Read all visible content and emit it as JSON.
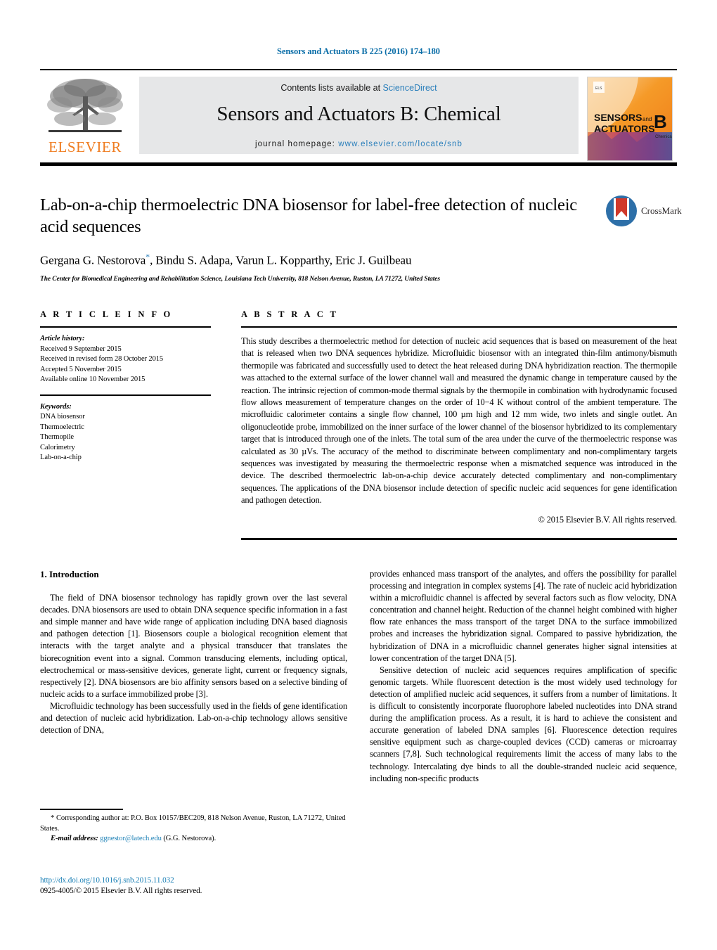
{
  "header": {
    "running_head": "Sensors and Actuators B 225 (2016) 174–180",
    "contents_prefix": "Contents lists available at ",
    "sciencedirect": "ScienceDirect",
    "journal_title": "Sensors and Actuators B: Chemical",
    "homepage_prefix": "journal homepage: ",
    "homepage_url": "www.elsevier.com/locate/snb",
    "publisher": "ELSEVIER",
    "cover_line1": "SENSORS",
    "cover_and": "and",
    "cover_line2": "ACTUATORS",
    "cover_letter": "B",
    "cover_sub": "Chemical"
  },
  "article": {
    "title": "Lab-on-a-chip thermoelectric DNA biosensor for label-free detection of nucleic acid sequences",
    "authors": "Gergana G. Nestorova",
    "authors_rest": ", Bindu S. Adapa, Varun L. Kopparthy, Eric J. Guilbeau",
    "corresponding_mark": "*",
    "affiliation": "The Center for Biomedical Engineering and Rehabilitation Science, Louisiana Tech University, 818 Nelson Avenue, Ruston, LA 71272, United States",
    "crossmark_label": "CrossMark"
  },
  "info": {
    "heading": "A R T I C L E   I N F O",
    "history_label": "Article history:",
    "history": [
      "Received 9 September 2015",
      "Received in revised form 28 October 2015",
      "Accepted 5 November 2015",
      "Available online 10 November 2015"
    ],
    "keywords_label": "Keywords:",
    "keywords": [
      "DNA biosensor",
      "Thermoelectric",
      "Thermopile",
      "Calorimetry",
      "Lab-on-a-chip"
    ]
  },
  "abstract": {
    "heading": "A B S T R A C T",
    "text": "This study describes a thermoelectric method for detection of nucleic acid sequences that is based on measurement of the heat that is released when two DNA sequences hybridize. Microfluidic biosensor with an integrated thin-film antimony/bismuth thermopile was fabricated and successfully used to detect the heat released during DNA hybridization reaction. The thermopile was attached to the external surface of the lower channel wall and measured the dynamic change in temperature caused by the reaction. The intrinsic rejection of common-mode thermal signals by the thermopile in combination with hydrodynamic focused flow allows measurement of temperature changes on the order of 10−4 K without control of the ambient temperature. The microfluidic calorimeter contains a single flow channel, 100 µm high and 12 mm wide, two inlets and single outlet. An oligonucleotide probe, immobilized on the inner surface of the lower channel of the biosensor hybridized to its complementary target that is introduced through one of the inlets. The total sum of the area under the curve of the thermoelectric response was calculated as 30 µVs. The accuracy of the method to discriminate between complimentary and non-complimentary targets sequences was investigated by measuring the thermoelectric response when a mismatched sequence was introduced in the device. The described thermoelectric lab-on-a-chip device accurately detected complimentary and non-complimentary sequences. The applications of the DNA biosensor include detection of specific nucleic acid sequences for gene identification and pathogen detection.",
    "copyright": "© 2015 Elsevier B.V. All rights reserved."
  },
  "body": {
    "section_number_title": "1.  Introduction",
    "left_paragraphs": [
      "The field of DNA biosensor technology has rapidly grown over the last several decades. DNA biosensors are used to obtain DNA sequence specific information in a fast and simple manner and have wide range of application including DNA based diagnosis and pathogen detection [1]. Biosensors couple a biological recognition element that interacts with the target analyte and a physical transducer that translates the biorecognition event into a signal. Common transducing elements, including optical, electrochemical or mass-sensitive devices, generate light, current or frequency signals, respectively [2]. DNA biosensors are bio affinity sensors based on a selective binding of nucleic acids to a surface immobilized probe [3].",
      "Microfluidic technology has been successfully used in the fields of gene identification and detection of nucleic acid hybridization. Lab-on-a-chip technology allows sensitive detection of DNA,"
    ],
    "right_paragraphs": [
      "provides enhanced mass transport of the analytes, and offers the possibility for parallel processing and integration in complex systems [4]. The rate of nucleic acid hybridization within a microfluidic channel is affected by several factors such as flow velocity, DNA concentration and channel height. Reduction of the channel height combined with higher flow rate enhances the mass transport of the target DNA to the surface immobilized probes and increases the hybridization signal. Compared to passive hybridization, the hybridization of DNA in a microfluidic channel generates higher signal intensities at lower concentration of the target DNA [5].",
      "Sensitive detection of nucleic acid sequences requires amplification of specific genomic targets. While fluorescent detection is the most widely used technology for detection of amplified nucleic acid sequences, it suffers from a number of limitations. It is difficult to consistently incorporate fluorophore labeled nucleotides into DNA strand during the amplification process. As a result, it is hard to achieve the consistent and accurate generation of labeled DNA samples [6]. Fluorescence detection requires sensitive equipment such as charge-coupled devices (CCD) cameras or microarray scanners [7,8]. Such technological requirements limit the access of many labs to the technology. Intercalating dye binds to all the double-stranded nucleic acid sequence, including non-specific products"
    ]
  },
  "footer": {
    "corresponding_star": "*",
    "corresponding_text": " Corresponding author at: P.O. Box 10157/BEC209, 818 Nelson Avenue, Ruston, LA 71272, United States.",
    "email_label": "E-mail address:",
    "email": "ggnestor@latech.edu",
    "email_suffix": " (G.G. Nestorova).",
    "doi": "http://dx.doi.org/10.1016/j.snb.2015.11.032",
    "issn_line": "0925-4005/© 2015 Elsevier B.V. All rights reserved."
  },
  "colors": {
    "link": "#1a7fb5",
    "header_blue": "#0b6ea8",
    "elsevier_orange": "#ef7d22",
    "band_gray": "#e6e7e8"
  }
}
